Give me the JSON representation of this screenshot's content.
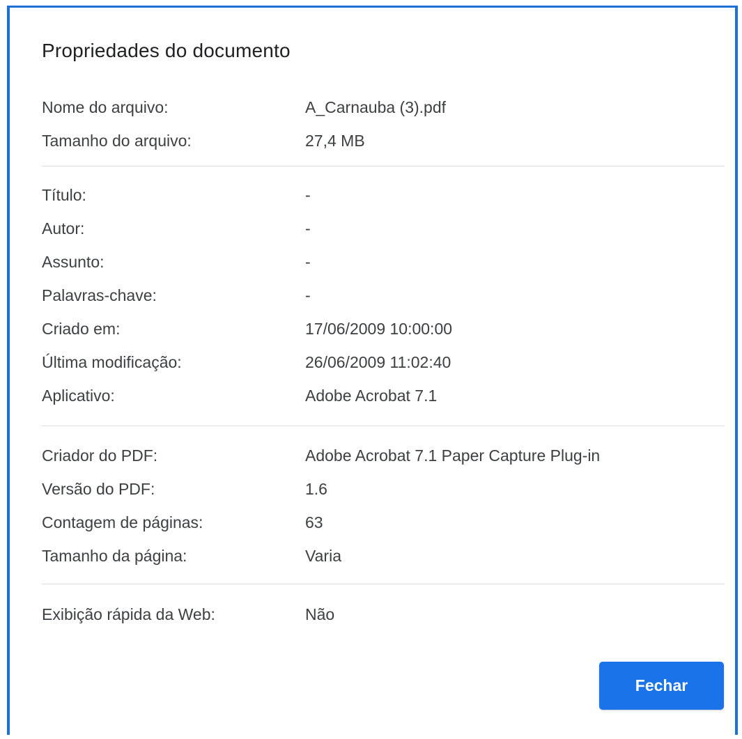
{
  "dialog": {
    "title": "Propriedades do documento",
    "close_label": "Fechar",
    "accent_color": "#1a73e8"
  },
  "sections": [
    [
      {
        "label": "Nome do arquivo:",
        "value": "A_Carnauba (3).pdf"
      },
      {
        "label": "Tamanho do arquivo:",
        "value": "27,4 MB"
      }
    ],
    [
      {
        "label": "Título:",
        "value": "-"
      },
      {
        "label": "Autor:",
        "value": "-"
      },
      {
        "label": "Assunto:",
        "value": "-"
      },
      {
        "label": "Palavras-chave:",
        "value": "-"
      },
      {
        "label": "Criado em:",
        "value": "17/06/2009 10:00:00"
      },
      {
        "label": "Última modificação:",
        "value": "26/06/2009 11:02:40"
      },
      {
        "label": "Aplicativo:",
        "value": "Adobe Acrobat 7.1"
      }
    ],
    [
      {
        "label": "Criador do PDF:",
        "value": "Adobe Acrobat 7.1 Paper Capture Plug-in"
      },
      {
        "label": "Versão do PDF:",
        "value": "1.6"
      },
      {
        "label": "Contagem de páginas:",
        "value": "63"
      },
      {
        "label": "Tamanho da página:",
        "value": "Varia"
      }
    ],
    [
      {
        "label": "Exibição rápida da Web:",
        "value": "Não"
      }
    ]
  ]
}
